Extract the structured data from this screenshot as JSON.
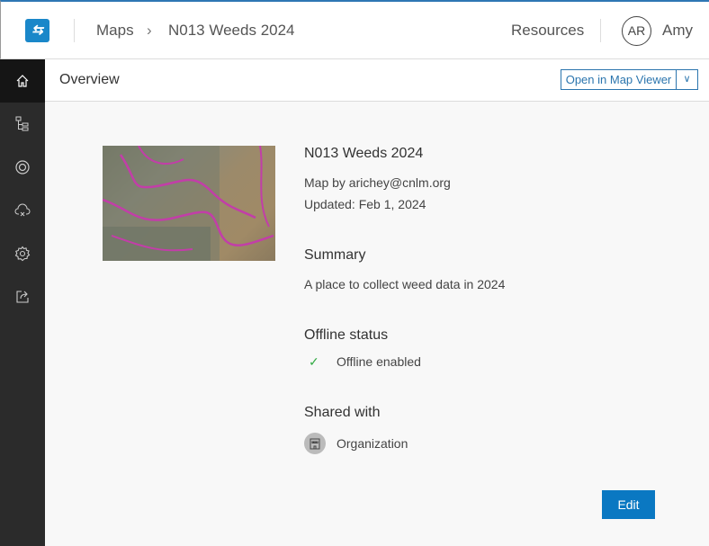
{
  "header": {
    "breadcrumb": [
      "Maps",
      "N013 Weeds 2024"
    ],
    "resources": "Resources",
    "avatar_initials": "AR",
    "user_name": "Amy"
  },
  "sidebar": {
    "items": [
      "home-icon",
      "layers-icon",
      "target-icon",
      "cloud-offline-icon",
      "gear-icon",
      "share-icon"
    ]
  },
  "subbar": {
    "title": "Overview",
    "open_label": "Open in Map Viewer"
  },
  "item": {
    "title": "N013 Weeds 2024",
    "owner": "Map by arichey@cnlm.org",
    "updated": "Updated: Feb 1, 2024"
  },
  "summary": {
    "heading": "Summary",
    "text": "A place to collect weed data in 2024"
  },
  "offline": {
    "heading": "Offline status",
    "status": "Offline enabled"
  },
  "shared": {
    "heading": "Shared with",
    "value": "Organization"
  },
  "edit_label": "Edit",
  "colors": {
    "accent": "#0a78c2",
    "sidebar": "#2b2b2b",
    "check": "#35ac46"
  }
}
